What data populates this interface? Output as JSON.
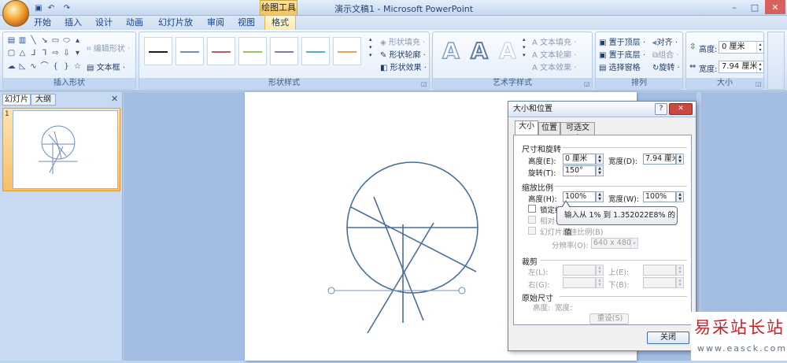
{
  "titlebar": {
    "tools_badge": "绘图工具",
    "doc_title": "演示文稿1 - Microsoft PowerPoint",
    "win_min": "–",
    "win_max": "□",
    "win_close": "✕"
  },
  "qat": {
    "save_icon": "save-icon",
    "undo_icon": "undo-icon",
    "redo_icon": "redo-icon"
  },
  "tabs": [
    "开始",
    "插入",
    "设计",
    "动画",
    "幻灯片放映",
    "审阅",
    "视图",
    "格式"
  ],
  "ribbon": {
    "insert_shapes": {
      "label": "插入形状",
      "edit_shape": "编辑形状 ·",
      "textbox": "文本框 ·"
    },
    "shape_styles": {
      "label": "形状样式",
      "fill": "形状填充 ·",
      "outline": "形状轮廓 ·",
      "effects": "形状效果 ·"
    },
    "wordart": {
      "label": "艺术字样式",
      "text_fill": "文本填充 ·",
      "text_outline": "文本轮廓 ·",
      "text_effects": "文本效果 ·"
    },
    "arrange": {
      "label": "排列",
      "bring_front": "置于顶层 ·",
      "send_back": "置于底层 ·",
      "selection_pane": "选择窗格",
      "align": "对齐 ·",
      "group": "组合 ·",
      "rotate": "旋转 ·"
    },
    "size": {
      "label": "大小",
      "height_label": "高度:",
      "height_value": "0 厘米",
      "width_label": "宽度:",
      "width_value": "7.94 厘米"
    }
  },
  "leftpane": {
    "tab_slides": "幻灯片",
    "tab_outline": "大纲",
    "close": "✕",
    "slide_number": "1"
  },
  "dialog": {
    "title": "大小和位置",
    "help": "?",
    "close_x": "✕",
    "tabs": [
      "大小",
      "位置",
      "可选文字"
    ],
    "size_rotate": {
      "heading": "尺寸和旋转",
      "height_label": "高度(E):",
      "height_value": "0 厘米",
      "width_label": "宽度(D):",
      "width_value": "7.94 厘米",
      "rotate_label": "旋转(T):",
      "rotate_value": "150°"
    },
    "scale": {
      "heading": "缩放比例",
      "height_label": "高度(H):",
      "height_value": "100%",
      "width_label": "宽度(W):",
      "width_value": "100%",
      "lock_label": "锁定纵横比(A)",
      "relative_label": "相对于",
      "slideshow_label": "幻灯片最佳比例(B)",
      "resolution_label": "分辨率(O):",
      "resolution_value": "640 x 480"
    },
    "crop": {
      "heading": "裁剪",
      "left": "左(L):",
      "top": "上(E):",
      "right": "右(G):",
      "bottom": "下(B):"
    },
    "original": {
      "heading": "原始尺寸",
      "height": "高度:",
      "width": "宽度:",
      "reset": "重设(S)"
    },
    "close_button": "关闭"
  },
  "tooltip": "输入从 1% 到 1.352022E8% 的值",
  "watermark": {
    "line1": "易采站长站",
    "line2": "www.easck.com"
  },
  "colors": {
    "accent": "#f2c35a",
    "shape_stroke": "#4a6e9a",
    "ribbon_text": "#15428b"
  }
}
